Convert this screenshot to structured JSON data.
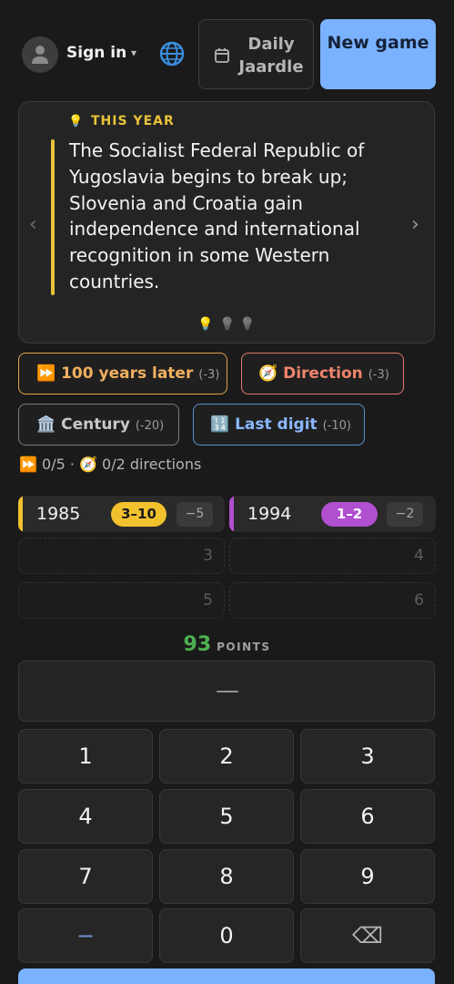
{
  "header": {
    "sign_in_label": "Sign in",
    "caret": "▾",
    "daily_label": "Daily Jaardle",
    "new_game_label": "New game"
  },
  "hint_card": {
    "eyebrow_icon": "💡",
    "eyebrow": "THIS YEAR",
    "text": "The Socialist Federal Republic of Yugoslavia begins to break up; Slovenia and Croatia gain independence and international recognition in some Western countries.",
    "nav_left": "‹",
    "nav_right": "›",
    "dots": [
      "💡",
      "💡",
      "💡"
    ]
  },
  "hints": [
    {
      "icon": "⏩",
      "label": "100 years later",
      "cost": "(-3)"
    },
    {
      "icon": "🧭",
      "label": "Direction",
      "cost": "(-3)"
    },
    {
      "icon": "🏛️",
      "label": "Century",
      "cost": "(-20)"
    },
    {
      "icon": "🔢",
      "label": "Last digit",
      "cost": "(-10)"
    }
  ],
  "progress": "⏩ 0/5 · 🧭 0/2 directions",
  "guesses": [
    {
      "year": "1985",
      "range": "3–10",
      "delta": "−5",
      "color": "#f2c12e"
    },
    {
      "year": "1994",
      "range": "1–2",
      "delta": "−2",
      "color": "#b04fd0"
    }
  ],
  "empty_slots": [
    "3",
    "4",
    "5",
    "6"
  ],
  "points": {
    "value": "93",
    "label": "POINTS"
  },
  "display": "—",
  "keypad": [
    "1",
    "2",
    "3",
    "4",
    "5",
    "6",
    "7",
    "8",
    "9",
    "−",
    "0",
    "⌫"
  ]
}
